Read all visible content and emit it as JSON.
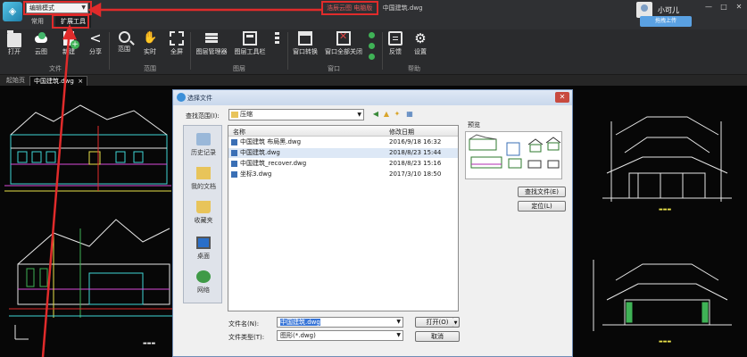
{
  "titlebar": {
    "mode_select": "编辑模式",
    "tabs": [
      "常用",
      "扩展工具"
    ],
    "window_title_product": "浩辰云图 电脑版",
    "window_title_file": "中国建筑.dwg",
    "user_name": "小可儿",
    "upload_button": "拖拽上传",
    "app_logo": "app-logo"
  },
  "toolbar": {
    "tools": [
      {
        "label": "打开",
        "icon": "folder-icon"
      },
      {
        "label": "云图",
        "icon": "cloud-icon"
      },
      {
        "label": "新建",
        "icon": "new-file-icon"
      },
      {
        "label": "分享",
        "icon": "share-icon"
      },
      {
        "label": "范围",
        "icon": "zoom-range-icon"
      },
      {
        "label": "实时",
        "icon": "pan-hand-icon"
      },
      {
        "label": "全屏",
        "icon": "fullscreen-icon"
      },
      {
        "label": "图层管理器",
        "icon": "layer-manager-icon"
      },
      {
        "label": "图层工具栏",
        "icon": "layer-toolbar-icon"
      },
      {
        "label": "窗口转换",
        "icon": "window-switch-icon"
      },
      {
        "label": "窗口全部关闭",
        "icon": "close-all-windows-icon"
      },
      {
        "label": "反馈",
        "icon": "feedback-icon"
      },
      {
        "label": "设置",
        "icon": "settings-icon"
      }
    ],
    "groups": [
      "文件",
      "范围",
      "图层",
      "窗口",
      "帮助"
    ]
  },
  "doc_tabs": [
    "起始页",
    "中国建筑.dwg"
  ],
  "dialog": {
    "title": "选择文件",
    "look_in_label": "查找范围(I):",
    "look_in_value": "压缩",
    "places": [
      "历史记录",
      "我的文档",
      "收藏夹",
      "桌面",
      "网络"
    ],
    "columns": {
      "name": "名称",
      "date": "修改日期"
    },
    "files": [
      {
        "name": "中国建筑 布局黑.dwg",
        "date": "2016/9/18 16:32"
      },
      {
        "name": "中国建筑.dwg",
        "date": "2018/8/23 15:44"
      },
      {
        "name": "中国建筑_recover.dwg",
        "date": "2018/8/23 15:16"
      },
      {
        "name": "坐标3.dwg",
        "date": "2017/3/10 18:50"
      }
    ],
    "selected_index": 1,
    "preview_label": "预览",
    "find_file_button": "查找文件(E)",
    "locate_button": "定位(L)",
    "file_name_label": "文件名(N):",
    "file_name_value": "中国建筑.dwg",
    "file_type_label": "文件类型(T):",
    "file_type_value": "图形(*.dwg)",
    "open_button": "打开(O)",
    "cancel_button": "取消"
  },
  "colors": {
    "annotation_red": "#e02b2b",
    "accent_green": "#3fb256",
    "cad_cyan": "#3fd6d6",
    "cad_yellow": "#e8e04a",
    "cad_magenta": "#d84bd8"
  }
}
